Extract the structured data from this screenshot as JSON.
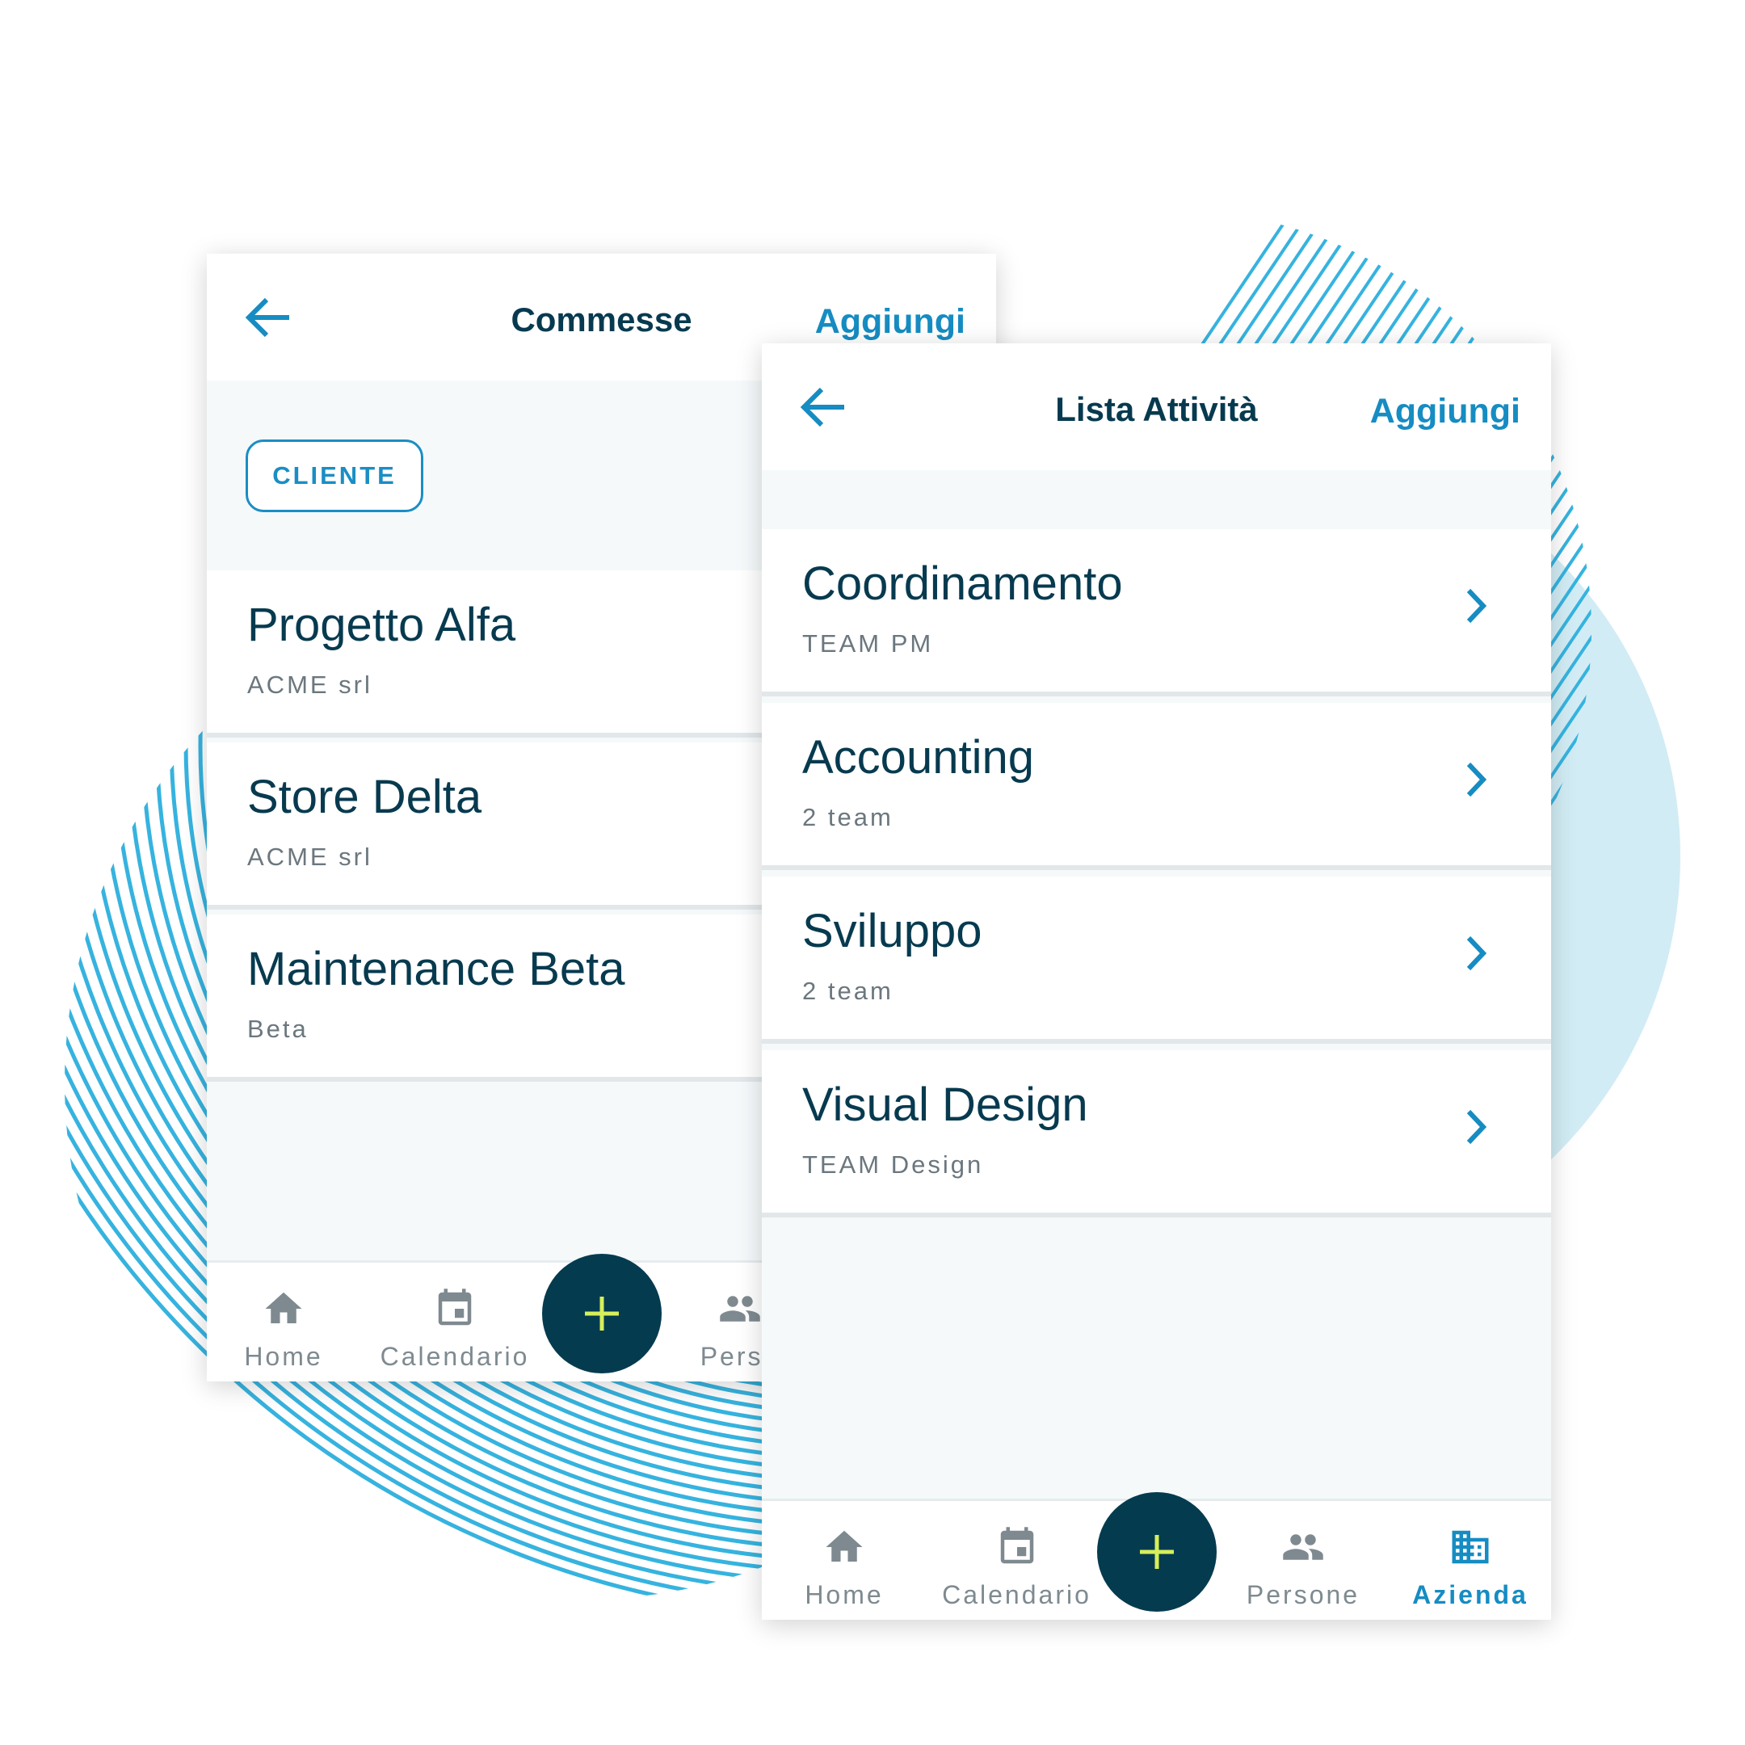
{
  "colors": {
    "accent": "#168cc2",
    "dark": "#073a4f",
    "fab": "#053b4f",
    "fab_plus": "#d6ef5a",
    "muted": "#7e8a90",
    "deco": "#36b3df"
  },
  "left_screen": {
    "title": "Commesse",
    "add_label": "Aggiungi",
    "back_icon": "arrow-left-icon",
    "filter_chip": "CLIENTE",
    "items": [
      {
        "name": "Progetto Alfa",
        "subtitle": "ACME srl"
      },
      {
        "name": "Store Delta",
        "subtitle": "ACME srl"
      },
      {
        "name": "Maintenance Beta",
        "subtitle": "Beta"
      }
    ],
    "nav": [
      {
        "label": "Home",
        "icon": "home-icon"
      },
      {
        "label": "Calendario",
        "icon": "calendar-icon"
      },
      {
        "label": "Perso",
        "icon": "people-icon"
      }
    ],
    "fab_icon": "plus-icon"
  },
  "right_screen": {
    "title": "Lista Attività",
    "add_label": "Aggiungi",
    "back_icon": "arrow-left-icon",
    "items": [
      {
        "name": "Coordinamento",
        "subtitle": "TEAM PM"
      },
      {
        "name": "Accounting",
        "subtitle": "2 team"
      },
      {
        "name": "Sviluppo",
        "subtitle": "2 team"
      },
      {
        "name": "Visual Design",
        "subtitle": "TEAM Design"
      }
    ],
    "nav": [
      {
        "label": "Home",
        "icon": "home-icon"
      },
      {
        "label": "Calendario",
        "icon": "calendar-icon"
      },
      {
        "label": "Persone",
        "icon": "people-icon"
      },
      {
        "label": "Azienda",
        "icon": "building-icon",
        "active": true
      }
    ],
    "fab_icon": "plus-icon"
  }
}
